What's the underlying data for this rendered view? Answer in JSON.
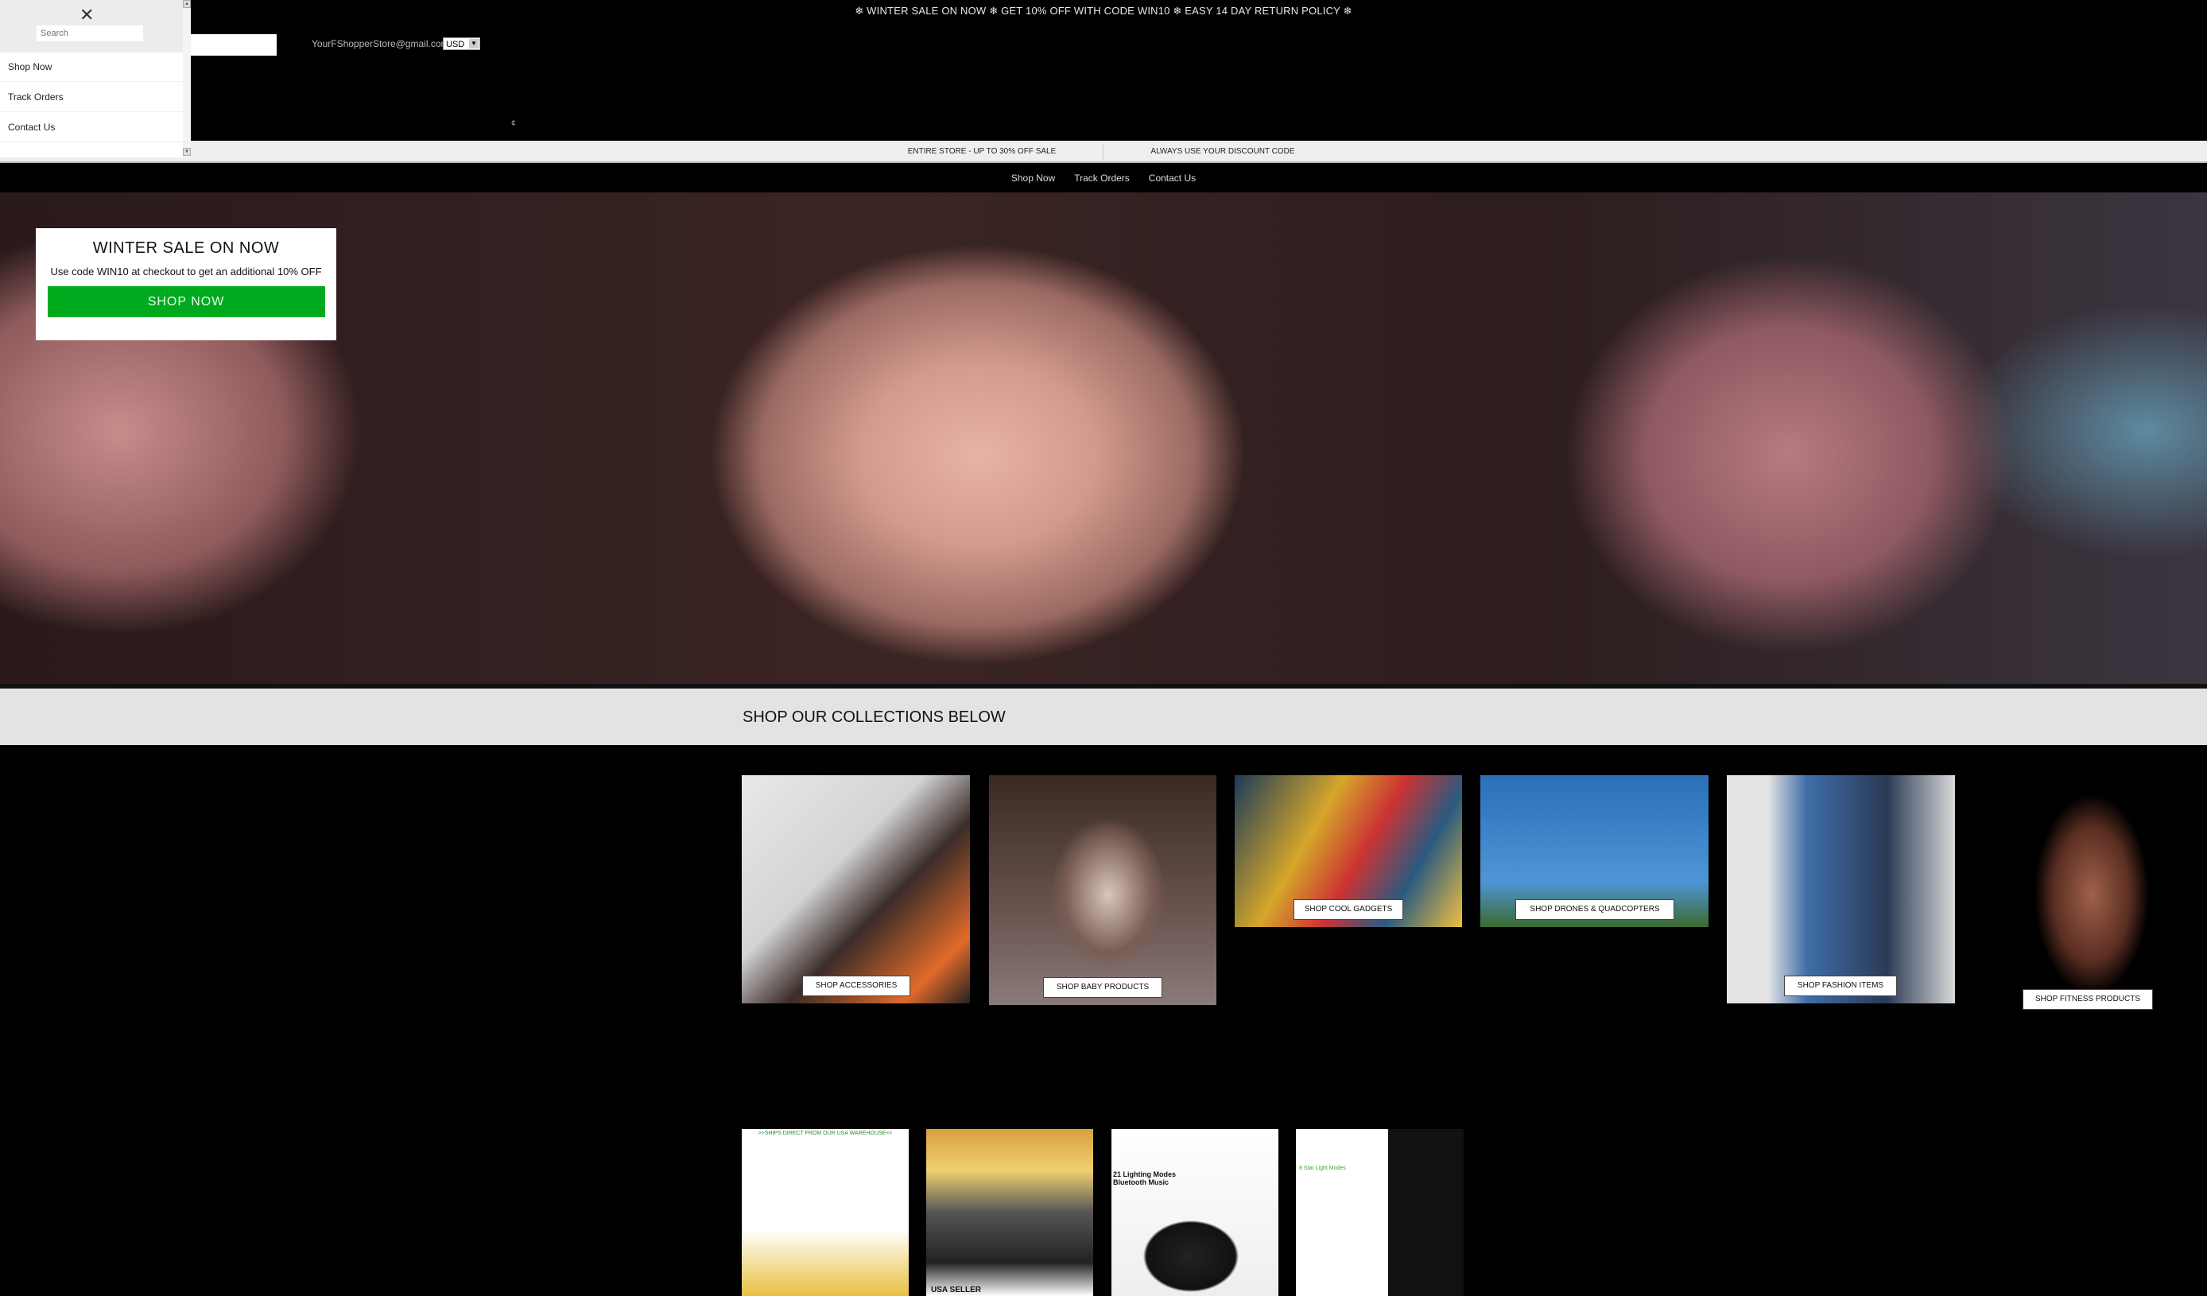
{
  "announcement": "❄ WINTER SALE ON NOW ❄ GET 10% OFF WITH CODE WIN10 ❄ EASY 14 DAY RETURN POLICY ❄",
  "header": {
    "email": "YourFShopperStore@gmail.com",
    "currency": "USD",
    "cart_glyph": "¢"
  },
  "strip": {
    "left": "ENTIRE STORE - UP TO 30% OFF SALE",
    "right": "ALWAYS USE YOUR DISCOUNT CODE"
  },
  "nav": [
    "Shop Now",
    "Track Orders",
    "Contact Us"
  ],
  "drawer": {
    "search_placeholder": "Search",
    "items": [
      "Shop Now",
      "Track Orders",
      "Contact Us"
    ]
  },
  "hero": {
    "title": "WINTER SALE ON NOW",
    "subtitle": "Use code  WIN10 at checkout to get an additional 10% OFF",
    "button": "SHOP NOW",
    "button_color": "#00aa1f"
  },
  "collections": {
    "title": "SHOP OUR COLLECTIONS BELOW",
    "items": [
      {
        "label": "SHOP ACCESSORIES"
      },
      {
        "label": "SHOP BABY PRODUCTS"
      },
      {
        "label": "SHOP COOL GADGETS"
      },
      {
        "label": "SHOP DRONES & QUADCOPTERS"
      },
      {
        "label": "SHOP FASHION ITEMS"
      },
      {
        "label": "SHOP FITNESS PRODUCTS"
      }
    ]
  },
  "products": [
    {
      "caption": ">>SHIPS DIRECT FROM OUR USA WAREHOUSE<<"
    },
    {
      "caption": "USA SELLER"
    },
    {
      "caption": "21 Lighting Modes Bluetooth Music"
    },
    {
      "caption": "8 Star Light Modes"
    }
  ]
}
